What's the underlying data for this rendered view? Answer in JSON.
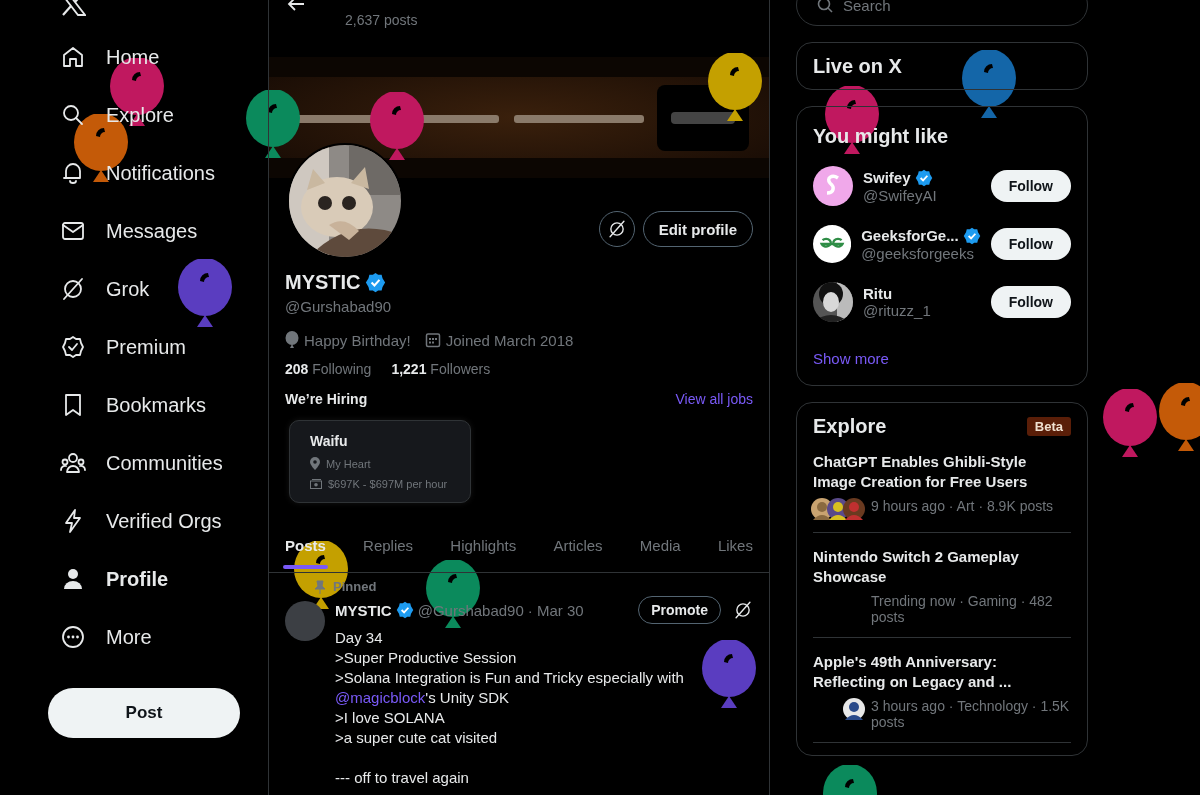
{
  "sidebar": {
    "items": [
      {
        "label": "Home",
        "selected": false
      },
      {
        "label": "Explore",
        "selected": false
      },
      {
        "label": "Notifications",
        "selected": false
      },
      {
        "label": "Messages",
        "selected": false
      },
      {
        "label": "Grok",
        "selected": false
      },
      {
        "label": "Premium",
        "selected": false
      },
      {
        "label": "Bookmarks",
        "selected": false
      },
      {
        "label": "Communities",
        "selected": false
      },
      {
        "label": "Verified Orgs",
        "selected": false
      },
      {
        "label": "Profile",
        "selected": true
      },
      {
        "label": "More",
        "selected": false
      }
    ],
    "post_button": "Post"
  },
  "header": {
    "posts_count": "2,637 posts"
  },
  "profile": {
    "name": "MYSTIC",
    "verified": true,
    "handle": "@Gurshabad90",
    "birthday": "Happy Birthday!",
    "joined": "Joined March 2018",
    "following_count": "208",
    "following_label": "Following",
    "followers_count": "1,221",
    "followers_label": "Followers",
    "edit_button": "Edit profile"
  },
  "hiring": {
    "title": "We’re Hiring",
    "link": "View all jobs",
    "jobs": [
      {
        "title": "Waifu",
        "location": "My Heart",
        "salary": "$697K - $697M per hour"
      }
    ]
  },
  "tabs": [
    {
      "label": "Posts",
      "selected": true
    },
    {
      "label": "Replies",
      "selected": false
    },
    {
      "label": "Highlights",
      "selected": false
    },
    {
      "label": "Articles",
      "selected": false
    },
    {
      "label": "Media",
      "selected": false
    },
    {
      "label": "Likes",
      "selected": false
    }
  ],
  "pinned_post": {
    "label": "Pinned",
    "name": "MYSTIC",
    "verified": true,
    "handle": "@Gurshabad90",
    "date": "· Mar 30",
    "promote_button": "Promote",
    "paragraphs": [
      [
        {
          "text": "Day 34"
        },
        {
          "text": ">Super Productive Session"
        },
        {
          "text": ">Solana Integration is Fun and Tricky especially with"
        },
        {
          "mention": "@magicblock",
          "text": "'s Unity SDK"
        },
        {
          "text": ">I love SOLANA"
        },
        {
          "text": ">a super cute cat visited"
        }
      ],
      [
        {
          "text": "--- off to travel again"
        }
      ]
    ]
  },
  "search": {
    "placeholder": "Search"
  },
  "live": {
    "title": "Live on X"
  },
  "suggestions": {
    "title": "You might like",
    "users": [
      {
        "name": "Swifey",
        "verified": true,
        "handle": "@SwifeyAI",
        "button": "Follow"
      },
      {
        "name": "GeeksforGe...",
        "verified": true,
        "handle": "@geeksforgeeks",
        "button": "Follow"
      },
      {
        "name": "Ritu",
        "verified": false,
        "handle": "@rituzz_1",
        "button": "Follow"
      }
    ],
    "show_more": "Show more"
  },
  "explore": {
    "title": "Explore",
    "badge": "Beta",
    "trends": [
      {
        "title": "ChatGPT Enables Ghibli-Style Image Creation for Free Users",
        "meta": "9 hours ago · Art · 8.9K posts",
        "kind": "stack"
      },
      {
        "title": "Nintendo Switch 2 Gameplay Showcase",
        "meta": "Trending now · Gaming · 482 posts",
        "kind": "none"
      },
      {
        "title": "Apple's 49th Anniversary: Reflecting on Legacy and ...",
        "meta": "3 hours ago · Technology · 1.5K posts",
        "kind": "single"
      }
    ]
  }
}
